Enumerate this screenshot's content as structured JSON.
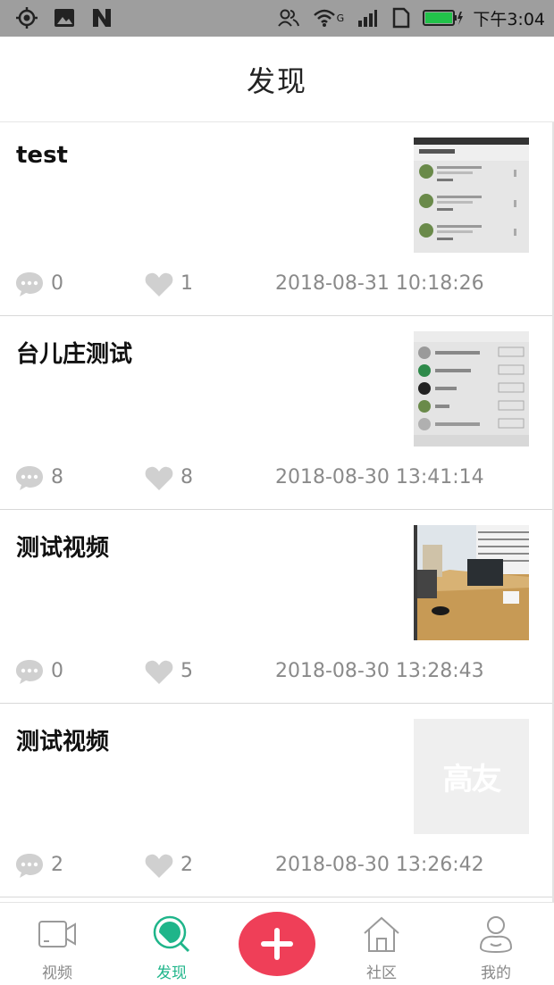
{
  "status_bar": {
    "time": "下午3:04",
    "network_label": "G",
    "icons": [
      "location-icon",
      "image-icon",
      "n-icon",
      "contacts-icon",
      "wifi-icon",
      "signal-icon",
      "sim-icon",
      "battery-icon"
    ],
    "battery_color": "#22c24a"
  },
  "header": {
    "title": "发现"
  },
  "posts": [
    {
      "title": "test",
      "comments": "0",
      "likes": "1",
      "time": "2018-08-31 10:18:26",
      "thumb": "comments-screenshot"
    },
    {
      "title": "台儿庄测试",
      "comments": "8",
      "likes": "8",
      "time": "2018-08-30 13:41:14",
      "thumb": "follow-list-screenshot"
    },
    {
      "title": "测试视频",
      "comments": "0",
      "likes": "5",
      "time": "2018-08-30 13:28:43",
      "thumb": "office-photo"
    },
    {
      "title": "测试视频",
      "comments": "2",
      "likes": "2",
      "time": "2018-08-30 13:26:42",
      "thumb": "placeholder-logo",
      "thumb_text": "高友"
    }
  ],
  "tabs": {
    "video": "视频",
    "discover": "发现",
    "community": "社区",
    "mine": "我的"
  },
  "colors": {
    "accent": "#1fb58a",
    "add_button": "#ef3f58",
    "meta_text": "#8a8a8a",
    "icon_gray": "#d0d0d0"
  }
}
